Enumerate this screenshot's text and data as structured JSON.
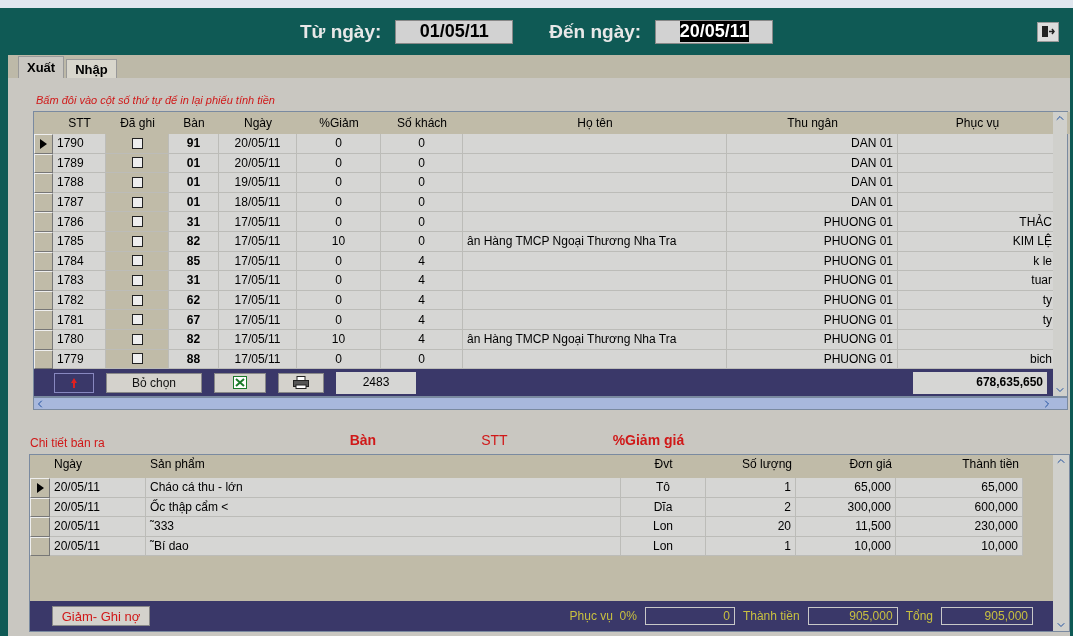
{
  "header": {
    "from_label": "Từ ngày:",
    "from_value": "01/05/11",
    "to_label": "Đến ngày:",
    "to_value": "20/05/11",
    "to_selected": true
  },
  "tabs": [
    {
      "label": "Xuất",
      "selected": true
    },
    {
      "label": "Nhập",
      "selected": false
    }
  ],
  "hint": "Bấm đôi vào cột số thứ tự để in lại phiếu tính tiền",
  "orders": {
    "columns": [
      "STT",
      "Đã ghi",
      "Bàn",
      "Ngày",
      "%Giảm",
      "Số khách",
      "Họ tên",
      "Thu ngân",
      "Phục vụ"
    ],
    "rows": [
      {
        "selected": true,
        "stt": "1790",
        "checked": false,
        "table": "91",
        "date": "20/05/11",
        "discount": "0",
        "guests": "0",
        "name": "",
        "cashier": "DAN 01",
        "server": ""
      },
      {
        "selected": false,
        "stt": "1789",
        "checked": false,
        "table": "01",
        "date": "20/05/11",
        "discount": "0",
        "guests": "0",
        "name": "",
        "cashier": "DAN 01",
        "server": ""
      },
      {
        "selected": false,
        "stt": "1788",
        "checked": false,
        "table": "01",
        "date": "19/05/11",
        "discount": "0",
        "guests": "0",
        "name": "",
        "cashier": "DAN 01",
        "server": ""
      },
      {
        "selected": false,
        "stt": "1787",
        "checked": false,
        "table": "01",
        "date": "18/05/11",
        "discount": "0",
        "guests": "0",
        "name": "",
        "cashier": "DAN 01",
        "server": ""
      },
      {
        "selected": false,
        "stt": "1786",
        "checked": false,
        "table": "31",
        "date": "17/05/11",
        "discount": "0",
        "guests": "0",
        "name": "",
        "cashier": "PHUONG 01",
        "server": "THẢC"
      },
      {
        "selected": false,
        "stt": "1785",
        "checked": false,
        "table": "82",
        "date": "17/05/11",
        "discount": "10",
        "guests": "0",
        "name": "ân Hàng TMCP Ngoại Thương Nha Tra",
        "cashier": "PHUONG 01",
        "server": "KIM LỆ"
      },
      {
        "selected": false,
        "stt": "1784",
        "checked": false,
        "table": "85",
        "date": "17/05/11",
        "discount": "0",
        "guests": "4",
        "name": "",
        "cashier": "PHUONG 01",
        "server": "k le"
      },
      {
        "selected": false,
        "stt": "1783",
        "checked": false,
        "table": "31",
        "date": "17/05/11",
        "discount": "0",
        "guests": "4",
        "name": "",
        "cashier": "PHUONG 01",
        "server": "tuar"
      },
      {
        "selected": false,
        "stt": "1782",
        "checked": false,
        "table": "62",
        "date": "17/05/11",
        "discount": "0",
        "guests": "4",
        "name": "",
        "cashier": "PHUONG 01",
        "server": "ty"
      },
      {
        "selected": false,
        "stt": "1781",
        "checked": false,
        "table": "67",
        "date": "17/05/11",
        "discount": "0",
        "guests": "4",
        "name": "",
        "cashier": "PHUONG 01",
        "server": "ty"
      },
      {
        "selected": false,
        "stt": "1780",
        "checked": false,
        "table": "82",
        "date": "17/05/11",
        "discount": "10",
        "guests": "4",
        "name": "ân Hàng TMCP Ngoại Thương Nha Tra",
        "cashier": "PHUONG 01",
        "server": ""
      },
      {
        "selected": false,
        "stt": "1779",
        "checked": false,
        "table": "88",
        "date": "17/05/11",
        "discount": "0",
        "guests": "0",
        "name": "",
        "cashier": "PHUONG 01",
        "server": "bich"
      }
    ],
    "footer": {
      "deselect": "Bỏ chọn",
      "count": "2483",
      "total": "678,635,650"
    }
  },
  "details": {
    "title": "Chi tiết bán ra",
    "labels": [
      "Bàn",
      "STT",
      "%Giảm giá"
    ],
    "columns": [
      "Ngày",
      "Sản phẩm",
      "Đvt",
      "Số lượng",
      "Đơn giá",
      "Thành tiền"
    ],
    "rows": [
      {
        "selected": true,
        "date": "20/05/11",
        "product": "Cháo cá thu - lớn",
        "unit": "Tô",
        "qty": "1",
        "price": "65,000",
        "amount": "65,000"
      },
      {
        "selected": false,
        "date": "20/05/11",
        "product": "Ốc thập cẩm <",
        "unit": "Dĩa",
        "qty": "2",
        "price": "300,000",
        "amount": "600,000"
      },
      {
        "selected": false,
        "date": "20/05/11",
        "product": "˜333",
        "unit": "Lon",
        "qty": "20",
        "price": "11,500",
        "amount": "230,000"
      },
      {
        "selected": false,
        "date": "20/05/11",
        "product": "˜Bí dao",
        "unit": "Lon",
        "qty": "1",
        "price": "10,000",
        "amount": "10,000"
      }
    ],
    "footer": {
      "button": "Giảm- Ghi nợ",
      "service_label": "Phục vụ  0%",
      "service_value": "0",
      "subtotal_label": "Thành tiền",
      "subtotal_value": "905,000",
      "total_label": "Tổng",
      "total_value": "905,000"
    }
  }
}
